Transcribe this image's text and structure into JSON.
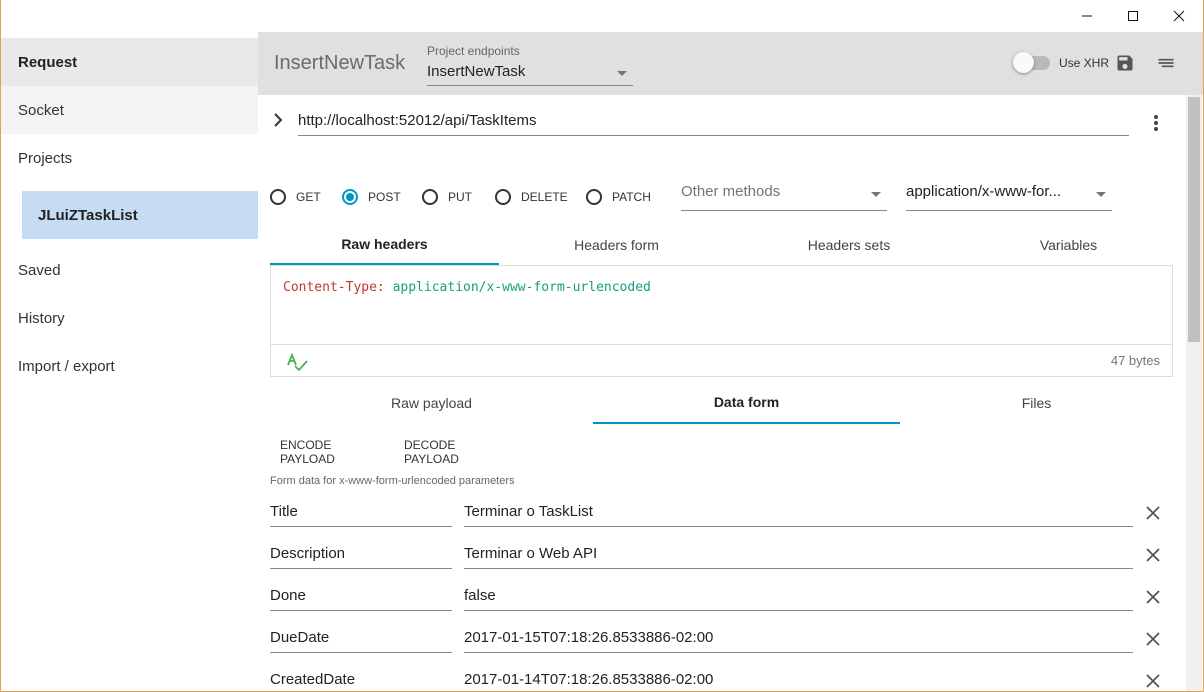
{
  "window": {
    "minimize_icon": "minimize-icon",
    "maximize_icon": "maximize-icon",
    "close_icon": "close-icon"
  },
  "sidebar": {
    "items": [
      {
        "label": "Request",
        "active": true
      },
      {
        "label": "Socket"
      },
      {
        "label": "Projects"
      },
      {
        "label": "Saved"
      },
      {
        "label": "History"
      },
      {
        "label": "Import / export"
      }
    ],
    "project": "JLuiZTaskList"
  },
  "toolbar": {
    "title": "InsertNewTask",
    "endpoints_label": "Project endpoints",
    "endpoint_selected": "InsertNewTask",
    "use_xhr_label": "Use XHR",
    "use_xhr_on": false
  },
  "request": {
    "url": "http://localhost:52012/api/TaskItems",
    "methods": [
      "GET",
      "POST",
      "PUT",
      "DELETE",
      "PATCH"
    ],
    "selected_method": "POST",
    "other_methods_placeholder": "Other methods",
    "content_type": "application/x-www-for..."
  },
  "headers_tabs": [
    "Raw headers",
    "Headers form",
    "Headers sets",
    "Variables"
  ],
  "headers_active_tab": "Raw headers",
  "headers_editor": {
    "key": "Content-Type:",
    "value": "application/x-www-form-urlencoded",
    "size": "47 bytes"
  },
  "payload_tabs": [
    "Raw payload",
    "Data form",
    "Files"
  ],
  "payload_active_tab": "Data form",
  "payload_buttons": {
    "encode": "ENCODE PAYLOAD",
    "decode": "DECODE PAYLOAD"
  },
  "form_hint": "Form data for x-www-form-urlencoded parameters",
  "form_rows": [
    {
      "name": "Title",
      "value": "Terminar o TaskList"
    },
    {
      "name": "Description",
      "value": "Terminar o Web API"
    },
    {
      "name": "Done",
      "value": "false"
    },
    {
      "name": "DueDate",
      "value": "2017-01-15T07:18:26.8533886-02:00"
    },
    {
      "name": "CreatedDate",
      "value": "2017-01-14T07:18:26.8533886-02:00"
    }
  ],
  "colors": {
    "accent": "#0097c7",
    "selected_project": "#c5dcf3",
    "toolbar": "#e0e0e0"
  }
}
